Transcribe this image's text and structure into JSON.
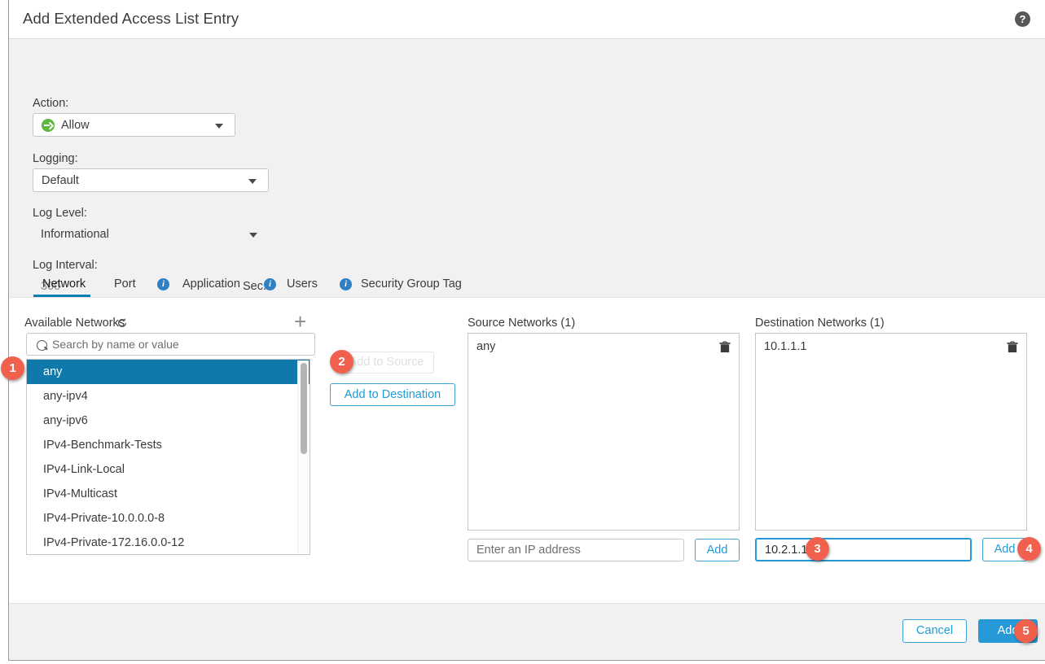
{
  "dialog": {
    "title": "Add Extended Access List Entry",
    "help_icon": "help-circle-icon"
  },
  "form": {
    "action": {
      "label": "Action:",
      "value": "Allow",
      "icon": "allow-arrow-icon"
    },
    "logging": {
      "label": "Logging:",
      "value": "Default"
    },
    "log_level": {
      "label": "Log Level:",
      "value": "Informational"
    },
    "log_interval": {
      "label": "Log Interval:",
      "value": "300",
      "unit": "Sec."
    }
  },
  "tabs": [
    {
      "label": "Network",
      "active": true,
      "info": false
    },
    {
      "label": "Port",
      "active": false,
      "info": false
    },
    {
      "label": "Application",
      "active": false,
      "info": true
    },
    {
      "label": "Users",
      "active": false,
      "info": true
    },
    {
      "label": "Security Group Tag",
      "active": false,
      "info": true
    }
  ],
  "available": {
    "title": "Available Networks",
    "refresh_icon": "refresh-icon",
    "add_icon": "plus-icon",
    "search_placeholder": "Search by name or value",
    "items": [
      "any",
      "any-ipv4",
      "any-ipv6",
      "IPv4-Benchmark-Tests",
      "IPv4-Link-Local",
      "IPv4-Multicast",
      "IPv4-Private-10.0.0.0-8",
      "IPv4-Private-172.16.0.0-12"
    ],
    "selected_index": 0
  },
  "transfer": {
    "add_to_source": "Add to Source",
    "add_to_source_disabled": true,
    "add_to_destination": "Add to Destination"
  },
  "source": {
    "title": "Source Networks (1)",
    "items": [
      "any"
    ],
    "input_placeholder": "Enter an IP address",
    "input_value": "",
    "add_label": "Add"
  },
  "destination": {
    "title": "Destination Networks (1)",
    "items": [
      "10.1.1.1"
    ],
    "input_placeholder": "",
    "input_value": "10.2.1.1",
    "add_label": "Add"
  },
  "footer": {
    "cancel": "Cancel",
    "add": "Add"
  },
  "badges": [
    "1",
    "2",
    "3",
    "4",
    "5"
  ],
  "colors": {
    "accent_blue": "#2699d6",
    "selection_blue": "#0f79ac",
    "tab_underline": "#0d7eb1",
    "badge_red": "#f0604c",
    "allow_green": "#5cb73d"
  }
}
